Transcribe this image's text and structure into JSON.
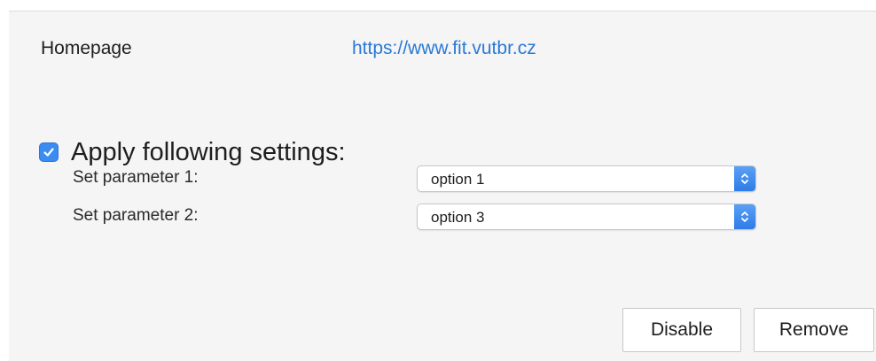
{
  "homepage": {
    "label": "Homepage",
    "url": "https://www.fit.vutbr.cz"
  },
  "apply_settings": {
    "label": "Apply following settings:",
    "checked": true,
    "accent_color": "#3b8cf0"
  },
  "parameters": [
    {
      "label": "Set parameter 1:",
      "value": "option 1"
    },
    {
      "label": "Set parameter 2:",
      "value": "option 3"
    }
  ],
  "buttons": {
    "disable_label": "Disable",
    "remove_label": "Remove"
  },
  "colors": {
    "link": "#2a79d6",
    "panel_background": "#f5f5f5"
  }
}
